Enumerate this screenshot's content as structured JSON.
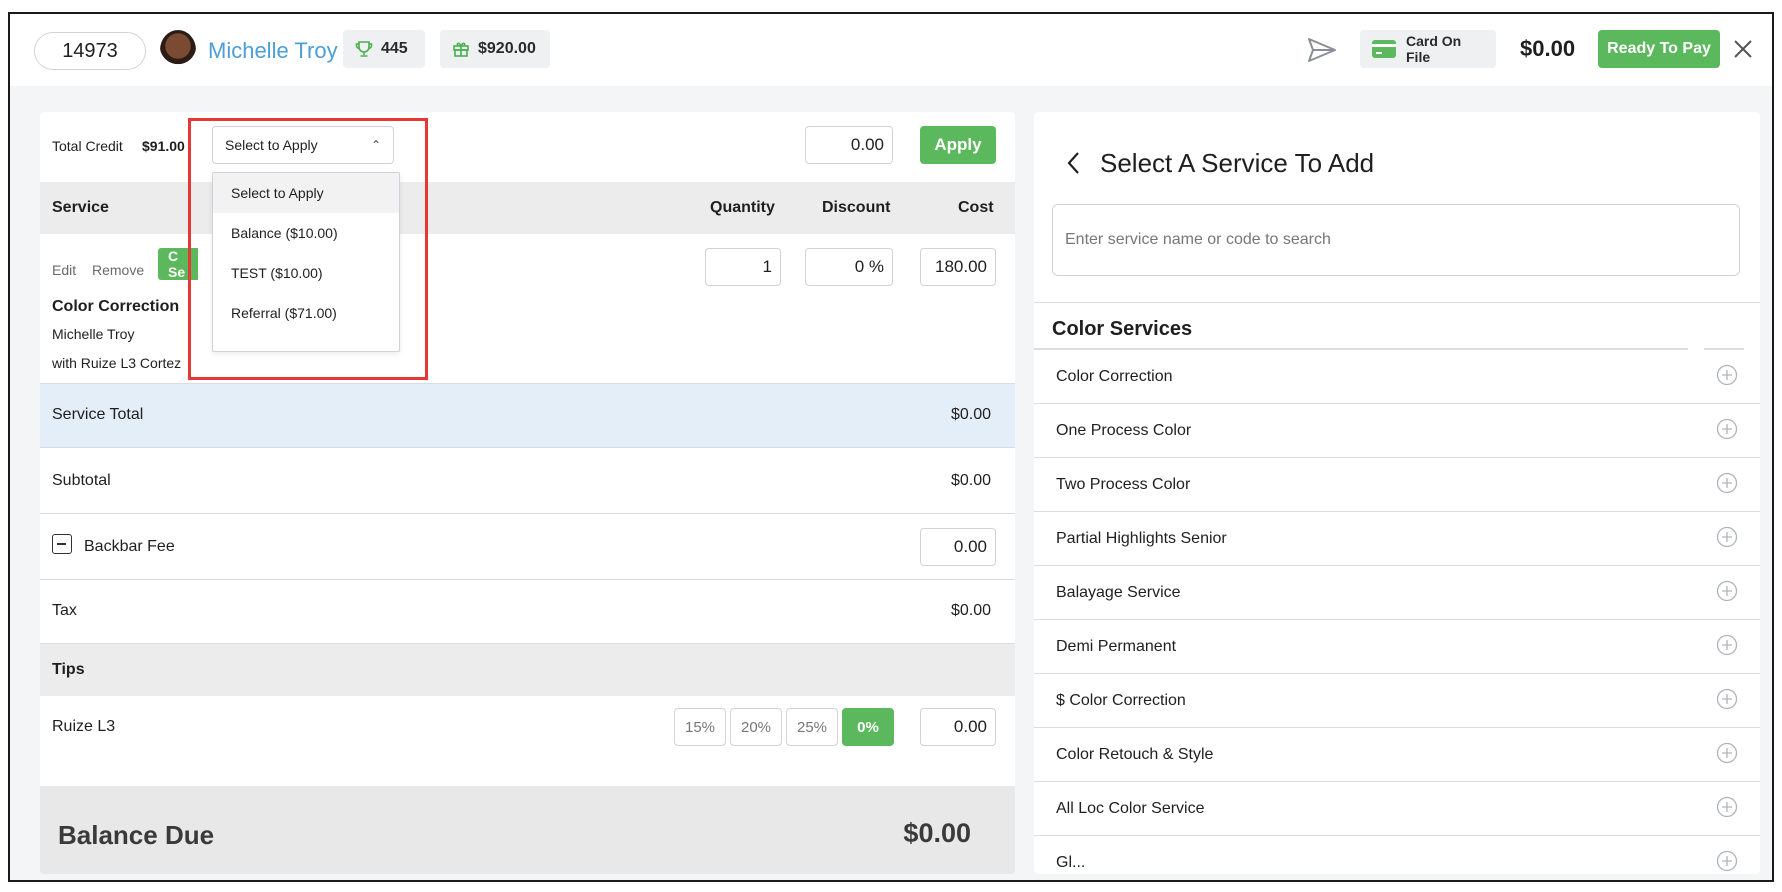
{
  "header": {
    "order_number": "14973",
    "client_name": "Michelle Troy",
    "points": "445",
    "gift_balance": "$920.00",
    "card_label": "Card On File",
    "total": "$0.00",
    "pay_label": "Ready To Pay"
  },
  "credit": {
    "label": "Total Credit",
    "value": "$91.00",
    "select_value": "Select to Apply",
    "amount": "0.00",
    "apply_label": "Apply",
    "options": [
      "Select to Apply",
      "Balance ($10.00)",
      "TEST ($10.00)",
      "Referral ($71.00)"
    ]
  },
  "table": {
    "headers": {
      "service": "Service",
      "quantity": "Quantity",
      "discount": "Discount",
      "cost": "Cost"
    }
  },
  "service_line": {
    "edit_label": "Edit",
    "remove_label": "Remove",
    "tag_label": "C Se",
    "name": "Color Correction",
    "client": "Michelle Troy",
    "staff": "with Ruize L3 Cortez",
    "quantity": "1",
    "discount": "0 %",
    "cost": "180.00"
  },
  "totals": {
    "service_total_label": "Service Total",
    "service_total": "$0.00",
    "subtotal_label": "Subtotal",
    "subtotal": "$0.00",
    "backbar_label": "Backbar Fee",
    "backbar_value": "0.00",
    "tax_label": "Tax",
    "tax": "$0.00"
  },
  "tips": {
    "header": "Tips",
    "staff": "Ruize L3",
    "options": [
      "15%",
      "20%",
      "25%",
      "0%"
    ],
    "value": "0.00"
  },
  "balance": {
    "label": "Balance Due",
    "value": "$0.00"
  },
  "service_panel": {
    "title": "Select A Service To Add",
    "search_placeholder": "Enter service name or code to search",
    "category": "Color Services",
    "services": [
      "Color Correction",
      "One Process Color",
      "Two Process Color",
      "Partial Highlights Senior",
      "Balayage Service",
      "Demi Permanent",
      "$ Color Correction",
      "Color Retouch & Style",
      "All Loc Color Service",
      "Gl..."
    ]
  },
  "colors": {
    "accent_green": "#5cb85c",
    "link_blue": "#4a9fd8",
    "highlight_red": "#e53935"
  }
}
